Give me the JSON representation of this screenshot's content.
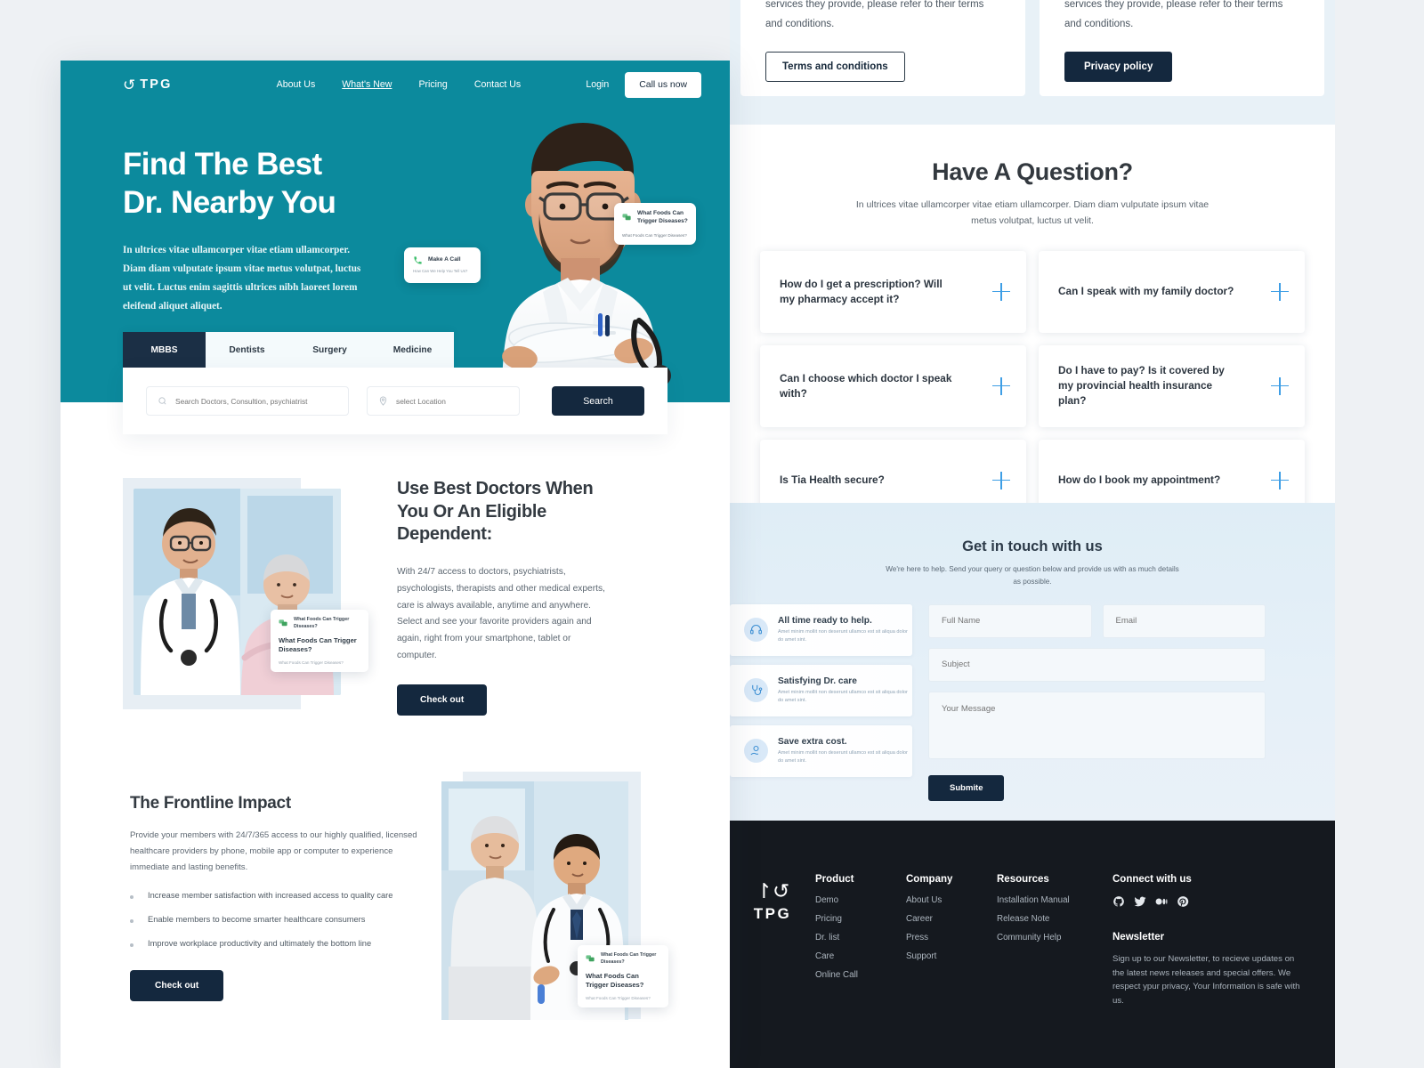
{
  "brand": {
    "name": "TPG",
    "teal": "#0c8a9d",
    "navy": "#14283e",
    "dark": "#15191f",
    "accent_blue": "#3e9ee5"
  },
  "nav": {
    "links": [
      {
        "label": "About Us",
        "active": false
      },
      {
        "label": "What's New",
        "active": true
      },
      {
        "label": "Pricing",
        "active": false
      },
      {
        "label": "Contact Us",
        "active": false
      }
    ],
    "login": "Login",
    "cta": "Call us now"
  },
  "hero": {
    "title_line1": "Find The Best",
    "title_line2": "Dr. Nearby You",
    "paragraph": "In ultrices vitae ullamcorper vitae etiam ullamcorper. Diam diam vulputate ipsum vitae metus volutpat, luctus ut velit. Luctus enim sagittis ultrices nibh laoreet lorem eleifend aliquet aliquet.",
    "bubble_call": {
      "title": "Make A Call",
      "subtitle": "How Can We Help You Tell Us?"
    },
    "bubble_foods": {
      "title": "What Foods Can Trigger Diseases?",
      "subtitle": "What Foods Can Trigger Diseases?"
    }
  },
  "tabs": [
    {
      "label": "MBBS",
      "active": true
    },
    {
      "label": "Dentists",
      "active": false
    },
    {
      "label": "Surgery",
      "active": false
    },
    {
      "label": "Medicine",
      "active": false
    }
  ],
  "search": {
    "doctor_placeholder": "Search Doctors, Consultion, psychiatrist",
    "location_placeholder": "select Location",
    "button": "Search"
  },
  "doctors_section": {
    "heading": "Use Best Doctors When You Or An Eligible Dependent:",
    "body": "With 24/7 access to doctors, psychiatrists, psychologists, therapists and other medical experts, care is always available, anytime and anywhere. Select and see your favorite providers again and again, right from your smartphone, tablet or computer.",
    "button": "Check out",
    "float_card": {
      "small_title": "What Foods Can Trigger Diseases?",
      "big_title": "What Foods Can Trigger Diseases?",
      "footer": "What Foods Can Trigger Diseases?"
    }
  },
  "frontline": {
    "heading": "The Frontline Impact",
    "body": "Provide your members with 24/7/365 access to our highly qualified, licensed healthcare providers by phone, mobile app or computer to experience immediate and lasting benefits.",
    "bullets": [
      "Increase member satisfaction with increased access to quality care",
      "Enable members to become smarter healthcare consumers",
      "Improve workplace productivity and ultimately the bottom line"
    ],
    "button": "Check out",
    "float_card": {
      "small_title": "What Foods Can Trigger Diseases?",
      "big_title": "What Foods Can Trigger Diseases?",
      "footer": "What Foods Can Trigger Diseases?"
    }
  },
  "legal": {
    "terms_text": "To learn more about the Babylon app and the services they provide, please refer to their terms and conditions.",
    "terms_button": "Terms and conditions",
    "privacy_text": "To learn more about the Babylon app and the services they provide, please refer to their terms and conditions.",
    "privacy_button": "Privacy policy"
  },
  "faq": {
    "title": "Have A Question?",
    "subtitle": "In ultrices vitae ullamcorper vitae etiam ullamcorper. Diam diam vulputate ipsum vitae metus volutpat, luctus ut velit.",
    "items": [
      {
        "q": "How do I get a prescription? Will my pharmacy accept it?"
      },
      {
        "q": "Can I speak with my family doctor?"
      },
      {
        "q": "Can I choose which doctor I speak with?"
      },
      {
        "q": "Do I have to pay? Is it covered by my provincial health insurance plan?"
      },
      {
        "q": "Is Tia Health secure?"
      },
      {
        "q": "How do I book my appointment?"
      }
    ]
  },
  "contact": {
    "title": "Get in touch with us",
    "subtitle": "We're here to help. Send your query or question below and provide us with as much details as possible.",
    "info_cards": [
      {
        "icon": "headset-24-icon",
        "title": "All time ready to help.",
        "text": "Amet minim mollit non deserunt ullamco est sit aliqua dolor do amet sint."
      },
      {
        "icon": "stethoscope-icon",
        "title": "Satisfying Dr. care",
        "text": "Amet minim mollit non deserunt ullamco est sit aliqua dolor do amet sint."
      },
      {
        "icon": "hand-coin-icon",
        "title": "Save extra cost.",
        "text": "Amet minim mollit non deserunt ullamco est sit aliqua dolor do amet sint."
      }
    ],
    "fields": {
      "full_name": "Full Name",
      "email": "Email",
      "subject": "Subject",
      "message": "Your Message"
    },
    "submit": "Submite"
  },
  "footer": {
    "logo": "TPG",
    "columns": [
      {
        "title": "Product",
        "links": [
          "Demo",
          "Pricing",
          "Dr. list",
          "Care",
          "Online Call"
        ]
      },
      {
        "title": "Company",
        "links": [
          "About Us",
          "Career",
          "Press",
          "Support"
        ]
      },
      {
        "title": "Resources",
        "links": [
          "Installation Manual",
          "Release Note",
          "Community Help"
        ]
      }
    ],
    "connect_title": "Connect with us",
    "social": [
      "github-icon",
      "twitter-icon",
      "medium-icon",
      "pinterest-icon"
    ],
    "newsletter_title": "Newsletter",
    "newsletter_text": "Sign up to our Newsletter, to recieve updates on the latest news releases and special offers. We respect ypur privacy, Your Information is safe with us."
  }
}
